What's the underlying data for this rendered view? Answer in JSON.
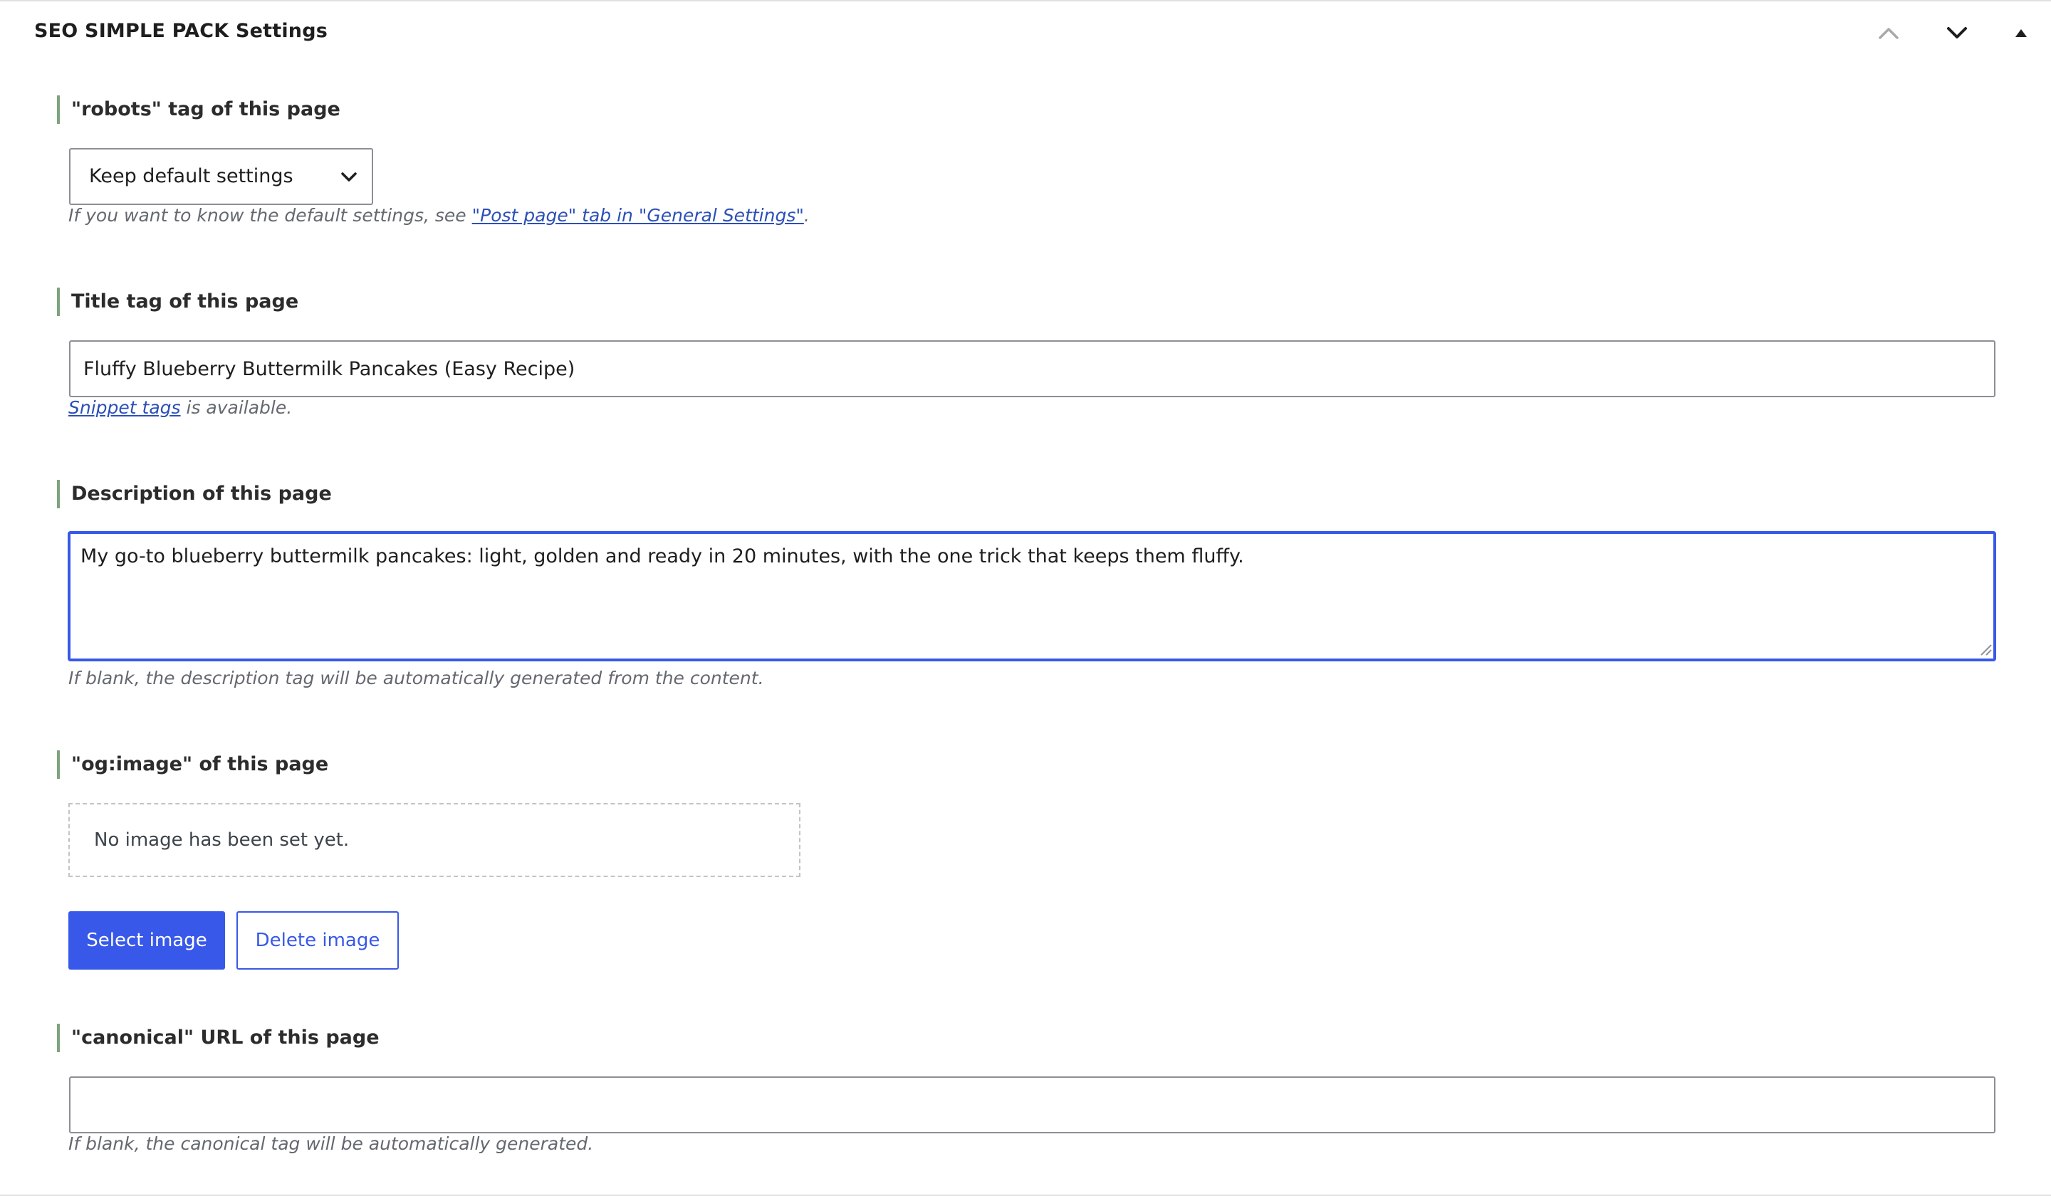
{
  "panel": {
    "title": "SEO SIMPLE PACK Settings",
    "controls": {
      "move_up_icon": "chevron-up-icon",
      "move_down_icon": "chevron-down-icon",
      "toggle_icon": "triangle-up-icon"
    }
  },
  "robots": {
    "label": "\"robots\" tag of this page",
    "selected_value": "Keep default settings",
    "help_prefix": "If you want to know the default settings, see ",
    "help_link": "\"Post page\" tab in \"General Settings\"",
    "help_suffix": "."
  },
  "title_tag": {
    "label": "Title tag of this page",
    "value": "Fluffy Blueberry Buttermilk Pancakes (Easy Recipe)",
    "help_link": "Snippet tags",
    "help_suffix": " is available."
  },
  "description": {
    "label": "Description of this page",
    "value": "My go-to blueberry buttermilk pancakes: light, golden and ready in 20 minutes, with the one trick that keeps them fluffy.",
    "help": "If blank, the description tag will be automatically generated from the content."
  },
  "og_image": {
    "label": "\"og:image\" of this page",
    "empty_text": "No image has been set yet.",
    "select_button": "Select image",
    "delete_button": "Delete image"
  },
  "canonical": {
    "label": "\"canonical\" URL of this page",
    "value": "",
    "help": "If blank, the canonical tag will be automatically generated."
  },
  "colors": {
    "accent": "#3858e9",
    "label_bar": "#7ea37e",
    "help_text": "#646970",
    "link": "#2c4fb8"
  }
}
